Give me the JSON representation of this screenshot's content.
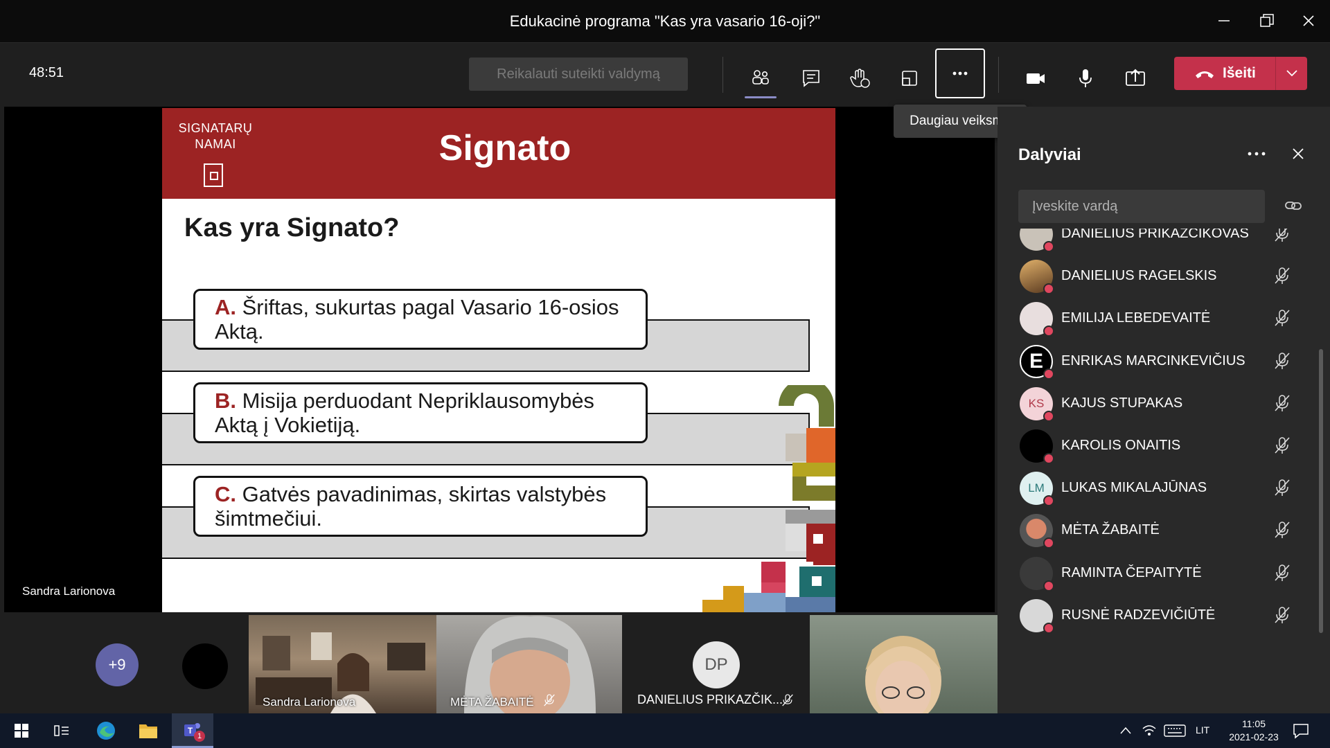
{
  "window": {
    "title": "Edukacinė programa \"Kas yra vasario 16-oji?\""
  },
  "toolbar": {
    "timer": "48:51",
    "request_control": "Reikalauti suteikti valdymą",
    "tooltip": "Daugiau veiksmų",
    "leave_label": "Išeiti",
    "icons": [
      "participants-icon",
      "chat-icon",
      "raise-hand-icon",
      "rooms-icon",
      "more-actions-icon",
      "camera-icon",
      "microphone-icon",
      "share-icon",
      "hang-up-icon"
    ]
  },
  "stage": {
    "presenter_name": "Sandra Larionova"
  },
  "slide": {
    "brand_line1": "SIGNATARŲ",
    "brand_line2": "NAMAI",
    "title": "Signato",
    "question": "Kas yra Signato?",
    "options": [
      {
        "letter": "A.",
        "text": "Šriftas, sukurtas pagal Vasario 16-osios Aktą."
      },
      {
        "letter": "B.",
        "text": "Misija perduodant Nepriklausomybės Aktą į Vokietiją."
      },
      {
        "letter": "C.",
        "text": "Gatvės pavadinimas, skirtas valstybės šimtmečiui."
      }
    ]
  },
  "thumbnails": {
    "more_count": "+9",
    "tiles": [
      {
        "name": "Sandra Larionova"
      },
      {
        "name": "MĖTA ŽABAITĖ"
      },
      {
        "name": "DANIELIUS PRIKAZČIK...",
        "initials": "DP"
      },
      {
        "name": ""
      }
    ]
  },
  "panel": {
    "title": "Dalyviai",
    "search_placeholder": "Įveskite vardą",
    "participants": [
      {
        "name": "DANIELIUS PRIKAZČIKOVAS",
        "initials": ""
      },
      {
        "name": "DANIELIUS RAGELSKIS",
        "initials": ""
      },
      {
        "name": "EMILIJA LEBEDEVAITĖ",
        "initials": ""
      },
      {
        "name": "ENRIKAS MARCINKEVIČIUS",
        "initials": "E"
      },
      {
        "name": "KAJUS STUPAKAS",
        "initials": "KS"
      },
      {
        "name": "KAROLIS ONAITIS",
        "initials": ""
      },
      {
        "name": "LUKAS MIKALAJŪNAS",
        "initials": "LM"
      },
      {
        "name": "MĖTA ŽABAITĖ",
        "initials": ""
      },
      {
        "name": "RAMINTA ČEPAITYTĖ",
        "initials": ""
      },
      {
        "name": "RUSNĖ RADZEVIČIŪTĖ",
        "initials": ""
      }
    ]
  },
  "taskbar": {
    "language": "LIT",
    "time": "11:05",
    "date": "2021-02-23",
    "teams_badge": "1"
  },
  "colors": {
    "accent_red": "#9c2323",
    "leave_red": "#c4314b",
    "teams_purple": "#6264a7",
    "status_red": "#e0475f"
  }
}
